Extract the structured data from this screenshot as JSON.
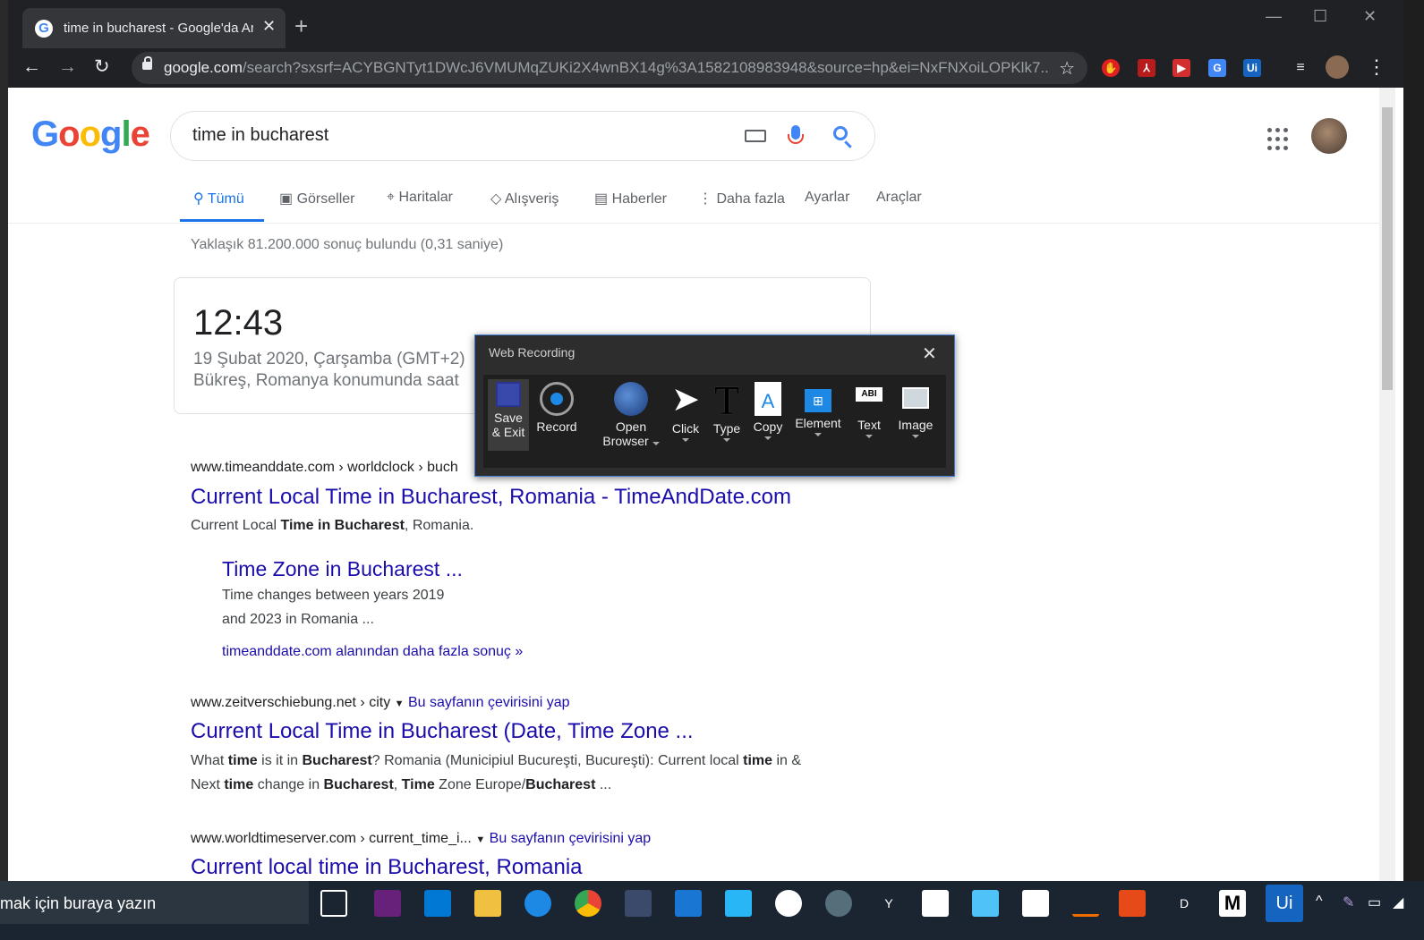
{
  "browser": {
    "tab_title": "time in bucharest - Google'da Ara",
    "tab_close": "✕",
    "new_tab": "+",
    "url_host": "google.com",
    "url_rest": "/search?sxsrf=ACYBGNTyt1DWcJ6VMUMqZUKi2X4wnBX14g%3A1582108983948&source=hp&ei=NxFNXoiLOPKlk7...",
    "window": {
      "minimize": "—",
      "maximize": "☐",
      "close": "✕"
    },
    "nav": {
      "back": "←",
      "forward": "→",
      "reload": "↻",
      "star": "☆",
      "menu": "⋮"
    },
    "extensions": [
      {
        "name": "adblock-icon",
        "glyph": "✋",
        "color": "#e02020"
      },
      {
        "name": "pdf-icon",
        "glyph": "⅄",
        "color": "#b71c1c"
      },
      {
        "name": "red-ext-icon",
        "glyph": "▶",
        "color": "#d32f2f"
      },
      {
        "name": "translate-icon",
        "glyph": "G",
        "color": "#4285f4"
      },
      {
        "name": "uipath-ext-icon",
        "glyph": "Ui",
        "color": "#1565c0"
      }
    ]
  },
  "google": {
    "logo": "Google",
    "query": "time in bucharest",
    "tabs": [
      {
        "label": "Tümü",
        "icon": "search-icon"
      },
      {
        "label": "Görseller",
        "icon": "image-icon"
      },
      {
        "label": "Haritalar",
        "icon": "map-pin-icon"
      },
      {
        "label": "Alışveriş",
        "icon": "tag-icon"
      },
      {
        "label": "Haberler",
        "icon": "news-icon"
      },
      {
        "label": "Daha fazla",
        "icon": "more-vert-icon"
      },
      {
        "label": "Ayarlar",
        "icon": ""
      },
      {
        "label": "Araçlar",
        "icon": ""
      }
    ],
    "stats": "Yaklaşık 81.200.000 sonuç bulundu (0,31 saniye)",
    "time_card": {
      "time": "12:43",
      "date": "19 Şubat 2020, Çarşamba (GMT+2)",
      "location": "Bükreş, Romanya konumunda saat"
    },
    "results": [
      {
        "cite": "www.timeanddate.com › worldclock › buch",
        "title": "Current Local Time in Bucharest, Romania - TimeAndDate.com",
        "snippet_parts": [
          "Current Local ",
          "Time in Bucharest",
          ", Romania."
        ],
        "sitelink_title": "Time Zone in Bucharest ...",
        "sitelink_line1": "Time changes between years 2019",
        "sitelink_line2": "and 2023 in Romania ...",
        "more": "timeanddate.com alanından daha fazla sonuç »"
      },
      {
        "cite": "www.zeitverschiebung.net › city",
        "translate": "Bu sayfanın çevirisini yap",
        "title": "Current Local Time in Bucharest (Date, Time Zone ...",
        "line1_parts": [
          "What ",
          "time",
          " is it in ",
          "Bucharest",
          "? Romania (Municipiul Bucureşti, Bucureşti): Current local ",
          "time",
          " in &"
        ],
        "line2_parts": [
          "Next ",
          "time",
          " change in ",
          "Bucharest",
          ", ",
          "Time",
          " Zone Europe/",
          "Bucharest",
          " ..."
        ]
      },
      {
        "cite": "www.worldtimeserver.com › current_time_i...",
        "translate": "Bu sayfanın çevirisini yap",
        "title": "Current local time in Bucharest, Romania"
      }
    ]
  },
  "recorder": {
    "title": "Web Recording",
    "close": "✕",
    "tools": [
      {
        "line1": "Save",
        "line2": "& Exit"
      },
      {
        "line1": "Record",
        "line2": ""
      },
      {
        "line1": "Open",
        "line2": "Browser"
      },
      {
        "line1": "Click",
        "line2": ""
      },
      {
        "line1": "Type",
        "line2": ""
      },
      {
        "line1": "Copy",
        "line2": ""
      },
      {
        "line1": "Element",
        "line2": ""
      },
      {
        "line1": "Text",
        "line2": ""
      },
      {
        "line1": "Image",
        "line2": ""
      }
    ]
  },
  "taskbar": {
    "search_text": "mak için buraya yazın"
  }
}
